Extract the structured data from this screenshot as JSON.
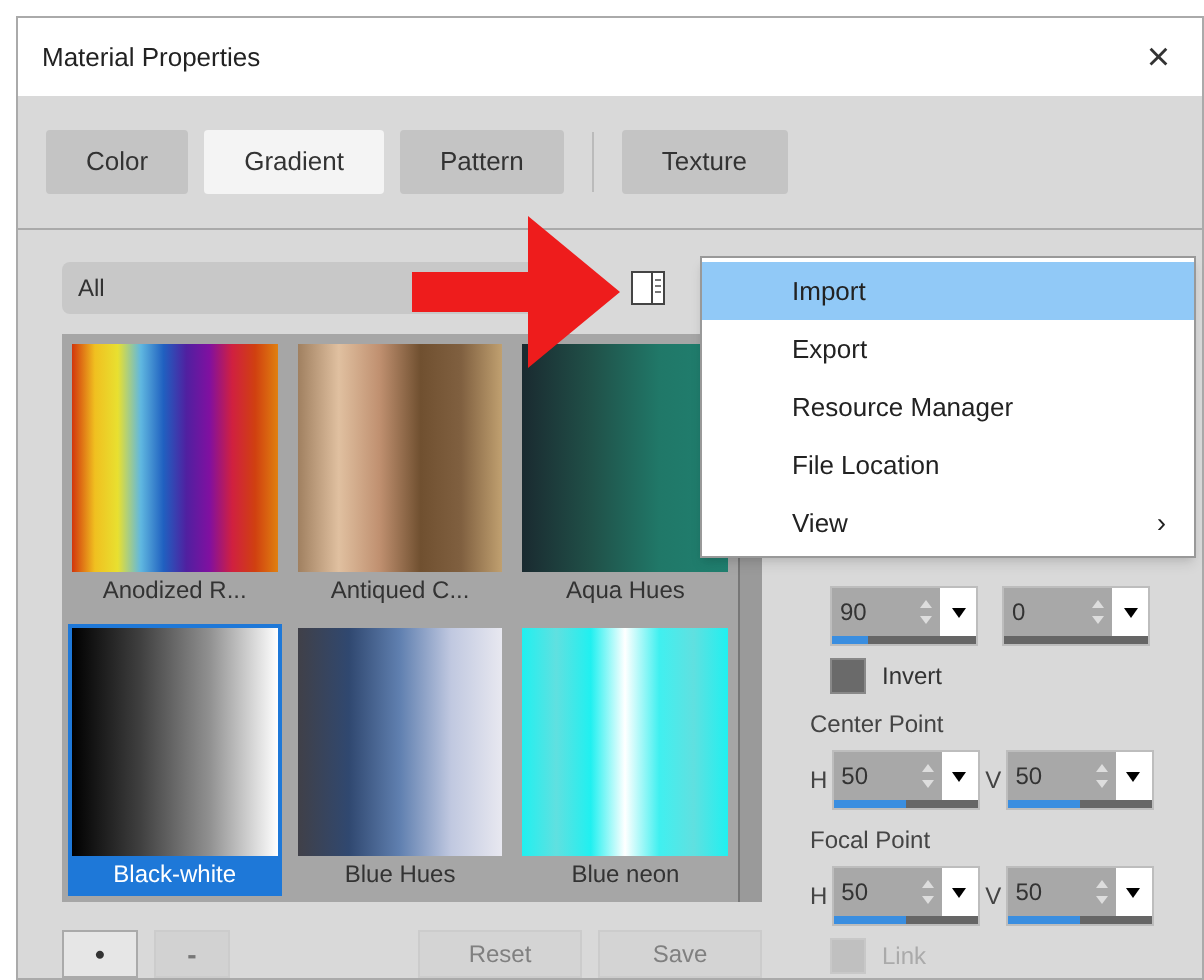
{
  "window": {
    "title": "Material Properties",
    "close": "×"
  },
  "tabs": [
    {
      "label": "Color",
      "selected": false
    },
    {
      "label": "Gradient",
      "selected": true
    },
    {
      "label": "Pattern",
      "selected": false
    },
    {
      "label": "Texture",
      "selected": false
    }
  ],
  "filter": {
    "value": "All"
  },
  "gradients": [
    {
      "name": "Anodized R...",
      "selected": false
    },
    {
      "name": "Antiqued C...",
      "selected": false
    },
    {
      "name": "Aqua Hues",
      "selected": false
    },
    {
      "name": "Black-white",
      "selected": true
    },
    {
      "name": "Blue Hues",
      "selected": false
    },
    {
      "name": "Blue neon",
      "selected": false
    }
  ],
  "menu": [
    {
      "label": "Import",
      "selected": true
    },
    {
      "label": "Export",
      "selected": false
    },
    {
      "label": "Resource Manager",
      "selected": false
    },
    {
      "label": "File Location",
      "selected": false
    },
    {
      "label": "View",
      "selected": false,
      "submenu": "›"
    }
  ],
  "angle_fields": [
    {
      "value": "90",
      "level": 0.25
    },
    {
      "value": "0"
    }
  ],
  "invert": {
    "label": "Invert",
    "checked": false,
    "disabled": false
  },
  "center_point": {
    "title": "Center Point",
    "fields": [
      {
        "axis": "H",
        "value": "50",
        "level": 0.5
      },
      {
        "axis": "V",
        "value": "50",
        "level": 0.5
      }
    ]
  },
  "focal_point": {
    "title": "Focal Point",
    "fields": [
      {
        "axis": "H",
        "value": "50",
        "level": 0.5
      },
      {
        "axis": "V",
        "value": "50",
        "level": 0.5
      }
    ]
  },
  "link": {
    "label": "Link",
    "checked": false,
    "disabled": true
  },
  "bottom_buttons": [
    {
      "label": "•",
      "disabled": false
    },
    {
      "label": "-",
      "disabled": true
    }
  ],
  "actions": [
    {
      "label": "Reset",
      "disabled": true
    },
    {
      "label": "Save",
      "disabled": true
    }
  ]
}
